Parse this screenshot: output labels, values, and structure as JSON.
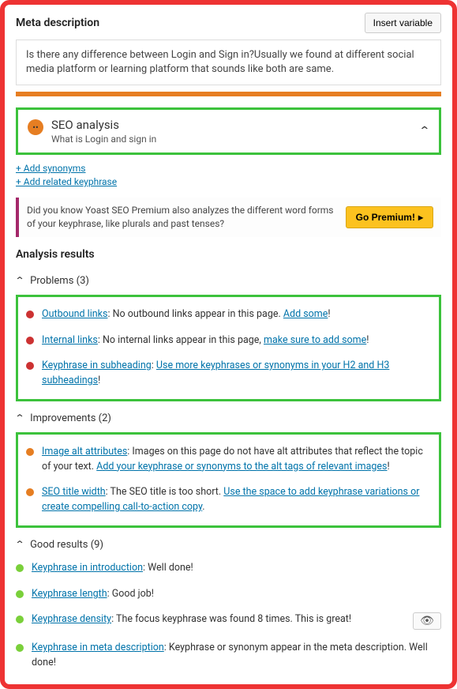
{
  "meta": {
    "section_title": "Meta description",
    "insert_var_btn": "Insert variable",
    "content": "Is there any difference between Login and Sign in?Usually we found at different social media platform or learning platform that sounds like both are same."
  },
  "seo": {
    "title": "SEO analysis",
    "subtitle": "What is Login and sign in"
  },
  "syn_links": {
    "add_synonyms": "+ Add synonyms",
    "add_related": "+ Add related keyphrase"
  },
  "premium": {
    "text": "Did you know Yoast SEO Premium also analyzes the different word forms of your keyphrase, like plurals and past tenses?",
    "button": "Go Premium!"
  },
  "analysis_heading": "Analysis results",
  "categories": {
    "problems": {
      "label": "Problems (3)"
    },
    "improvements": {
      "label": "Improvements (2)"
    },
    "good": {
      "label": "Good results (9)"
    }
  },
  "problems": [
    {
      "title": "Outbound links",
      "text": ": No outbound links appear in this page. ",
      "link2": "Add some",
      "after2": "!"
    },
    {
      "title": "Internal links",
      "text": ": No internal links appear in this page, ",
      "link2": "make sure to add some",
      "after2": "!"
    },
    {
      "title": "Keyphrase in subheading",
      "text": ": ",
      "link2": "Use more keyphrases or synonyms in your H2 and H3 subheadings",
      "after2": "!"
    }
  ],
  "improvements": [
    {
      "title": "Image alt attributes",
      "text": ": Images on this page do not have alt attributes that reflect the topic of your text. ",
      "link2": "Add your keyphrase or synonyms to the alt tags of relevant images",
      "after2": "!"
    },
    {
      "title": "SEO title width",
      "text": ": The SEO title is too short. ",
      "link2": "Use the space to add keyphrase variations or create compelling call-to-action copy",
      "after2": "."
    }
  ],
  "good": [
    {
      "title": "Keyphrase in introduction",
      "text": ": Well done!"
    },
    {
      "title": "Keyphrase length",
      "text": ": Good job!"
    },
    {
      "title": "Keyphrase density",
      "text": ": The focus keyphrase was found 8 times. This is great!",
      "eye": true
    },
    {
      "title": "Keyphrase in meta description",
      "text": ": Keyphrase or synonym appear in the meta description. Well done!"
    }
  ]
}
